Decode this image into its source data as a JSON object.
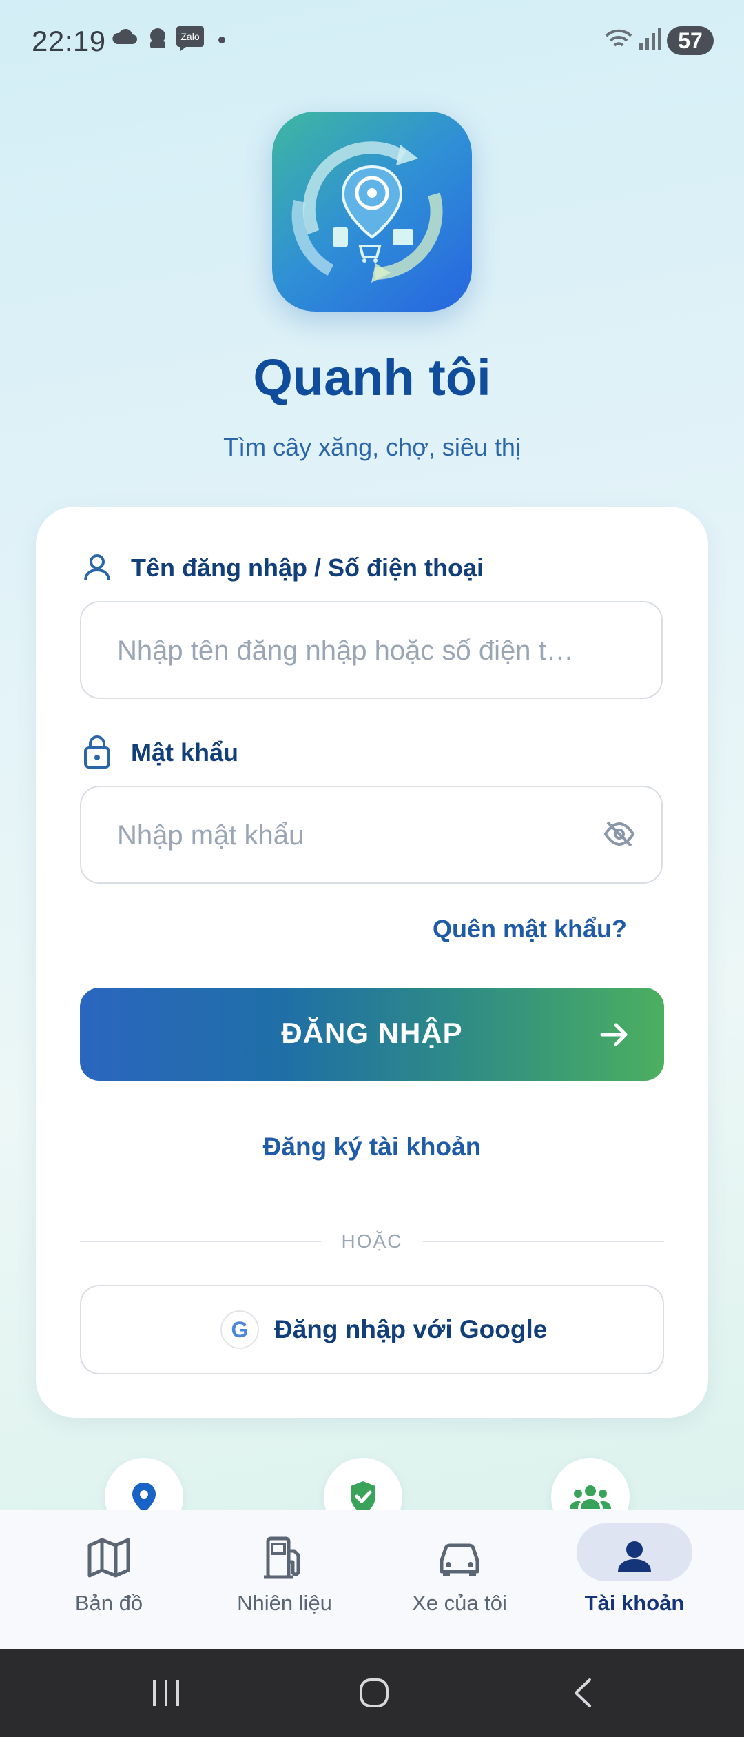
{
  "status_bar": {
    "time": "22:19",
    "battery": "57",
    "icons": [
      "cloud-icon",
      "alert-icon",
      "zalo-icon",
      "dot-icon",
      "wifi-icon",
      "signal-icon"
    ]
  },
  "app": {
    "title": "Quanh tôi",
    "subtitle": "Tìm cây xăng, chợ, siêu thị"
  },
  "form": {
    "username_label": "Tên đăng nhập / Số điện thoại",
    "username_placeholder": "Nhập tên đăng nhập hoặc số điện t…",
    "password_label": "Mật khẩu",
    "password_placeholder": "Nhập mật khẩu",
    "forgot_password": "Quên mật khẩu?",
    "login_button": "ĐĂNG NHẬP",
    "register_link": "Đăng ký tài khoản",
    "divider": "HOẶC",
    "google_glyph": "G",
    "google_button": "Đăng nhập với Google"
  },
  "colors": {
    "primary": "#0f4c9c",
    "accent_green": "#4caf5f",
    "link": "#1f5ba6"
  },
  "bottom_nav": {
    "items": [
      {
        "label": "Bản đồ",
        "icon": "map-icon",
        "active": false
      },
      {
        "label": "Nhiên liệu",
        "icon": "fuel-icon",
        "active": false
      },
      {
        "label": "Xe của tôi",
        "icon": "car-icon",
        "active": false
      },
      {
        "label": "Tài khoản",
        "icon": "person-icon",
        "active": true
      }
    ]
  }
}
